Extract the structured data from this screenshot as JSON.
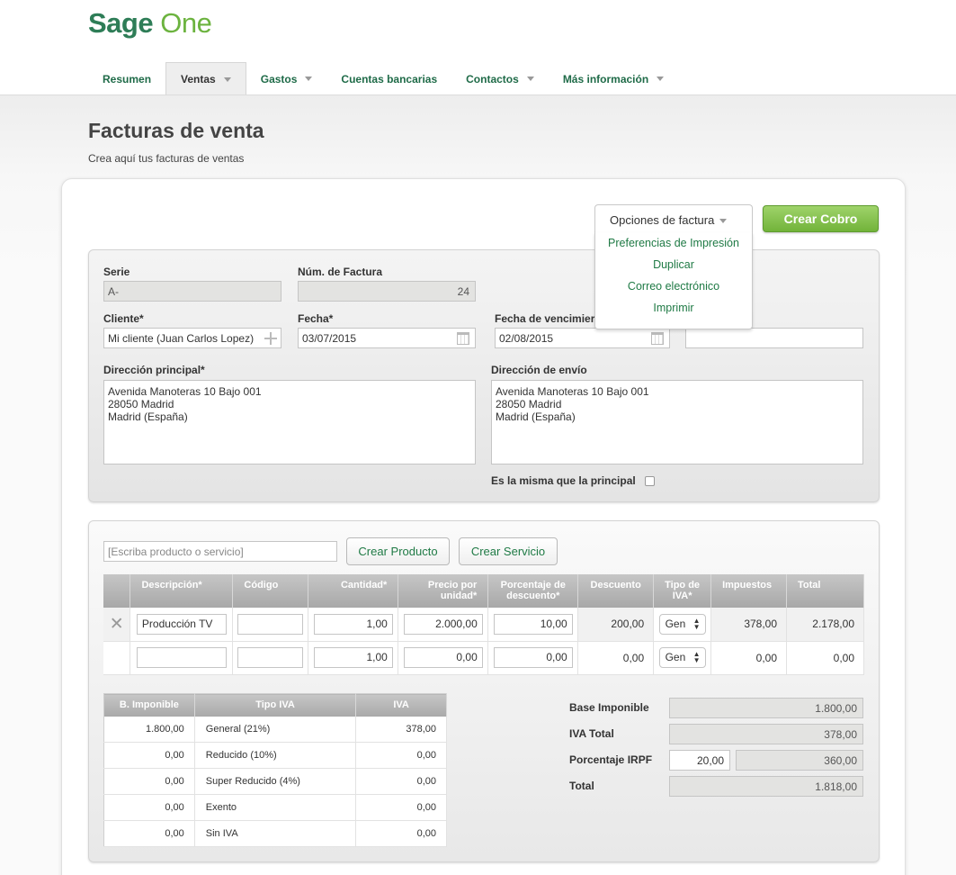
{
  "brand": {
    "name_a": "Sage",
    "name_b": "One"
  },
  "nav": [
    {
      "label": "Resumen",
      "dropdown": false,
      "active": false
    },
    {
      "label": "Ventas",
      "dropdown": true,
      "active": true
    },
    {
      "label": "Gastos",
      "dropdown": true,
      "active": false
    },
    {
      "label": "Cuentas bancarias",
      "dropdown": false,
      "active": false
    },
    {
      "label": "Contactos",
      "dropdown": true,
      "active": false
    },
    {
      "label": "Más información",
      "dropdown": true,
      "active": false
    }
  ],
  "page": {
    "title": "Facturas de venta",
    "subtitle": "Crea aquí tus facturas de ventas"
  },
  "actions": {
    "options_label": "Opciones de factura",
    "options_menu": [
      "Preferencias de Impresión",
      "Duplicar",
      "Correo electrónico",
      "Imprimir"
    ],
    "create_payment": "Crear Cobro"
  },
  "form": {
    "serie_label": "Serie",
    "serie_value": "A-",
    "numero_label": "Núm. de Factura",
    "numero_value": "24",
    "cliente_label": "Cliente*",
    "cliente_value": "Mi cliente (Juan Carlos Lopez)",
    "fecha_label": "Fecha*",
    "fecha_value": "03/07/2015",
    "vencimiento_label": "Fecha de vencimier",
    "vencimiento_value": "02/08/2015",
    "extra_value": "",
    "dir_principal_label": "Dirección principal*",
    "dir_principal_lines": [
      "Avenida Manoteras 10 Bajo 001",
      "28050 Madrid",
      "Madrid (España)"
    ],
    "dir_envio_label": "Dirección de envío",
    "dir_envio_lines": [
      "Avenida Manoteras 10 Bajo 001",
      "28050 Madrid",
      "Madrid (España)"
    ],
    "same_label": "Es la misma que la principal",
    "same_checked": false
  },
  "lines": {
    "search_placeholder": "[Escriba producto o servicio]",
    "create_product": "Crear Producto",
    "create_service": "Crear Servicio",
    "headers": [
      "Descripción*",
      "Código",
      "Cantidad*",
      "Precio por unidad*",
      "Porcentaje de descuento*",
      "Descuento",
      "Tipo de IVA*",
      "Impuestos",
      "Total"
    ],
    "rows": [
      {
        "descripcion": "Producción TV",
        "codigo": "",
        "cantidad": "1,00",
        "precio": "2.000,00",
        "porc_desc": "10,00",
        "descuento": "200,00",
        "tipo_iva": "Gen",
        "impuestos": "378,00",
        "total": "2.178,00"
      },
      {
        "descripcion": "",
        "codigo": "",
        "cantidad": "1,00",
        "precio": "0,00",
        "porc_desc": "0,00",
        "descuento": "0,00",
        "tipo_iva": "Gen",
        "impuestos": "0,00",
        "total": "0,00"
      }
    ]
  },
  "vat_summary": {
    "headers": [
      "B. Imponible",
      "Tipo IVA",
      "IVA"
    ],
    "rows": [
      {
        "base": "1.800,00",
        "tipo": "General (21%)",
        "iva": "378,00"
      },
      {
        "base": "0,00",
        "tipo": "Reducido (10%)",
        "iva": "0,00"
      },
      {
        "base": "0,00",
        "tipo": "Super Reducido (4%)",
        "iva": "0,00"
      },
      {
        "base": "0,00",
        "tipo": "Exento",
        "iva": "0,00"
      },
      {
        "base": "0,00",
        "tipo": "Sin IVA",
        "iva": "0,00"
      }
    ]
  },
  "totals": {
    "base_label": "Base Imponible",
    "base_value": "1.800,00",
    "iva_label": "IVA Total",
    "iva_value": "378,00",
    "irpf_label": "Porcentaje IRPF",
    "irpf_pct": "20,00",
    "irpf_value": "360,00",
    "total_label": "Total",
    "total_value": "1.818,00"
  }
}
